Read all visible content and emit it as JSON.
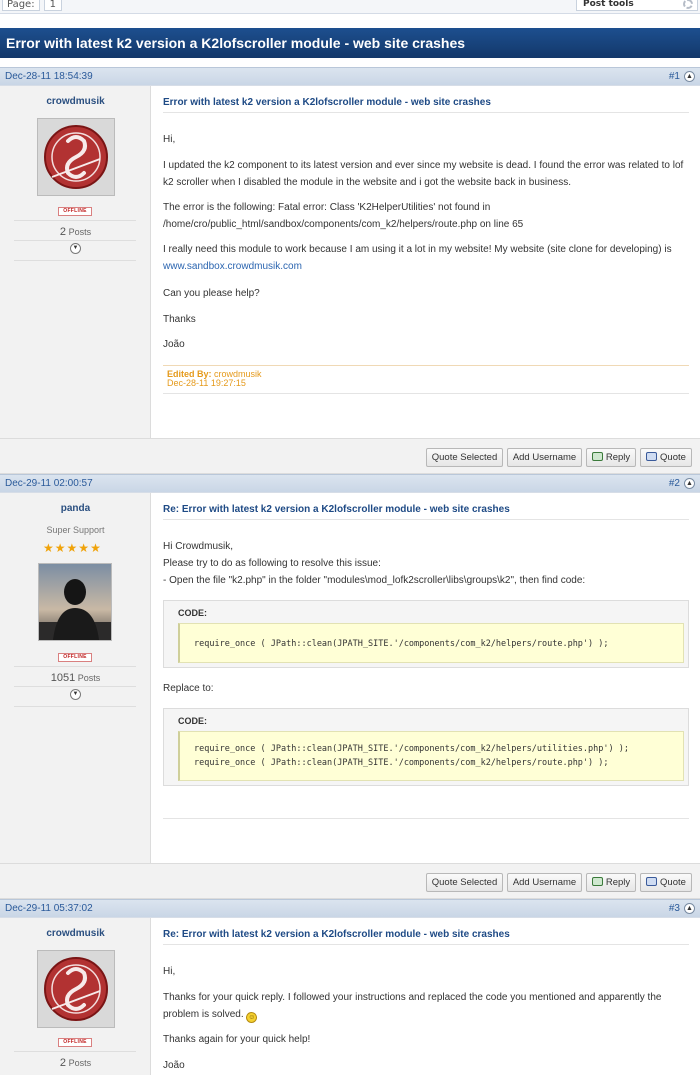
{
  "pager": {
    "label": "Page:",
    "current": "1"
  },
  "post_tools": "Post tools",
  "thread_title": "Error with latest k2 version a K2lofscroller module - web site crashes",
  "buttons": {
    "quote_selected": "Quote Selected",
    "add_username": "Add Username",
    "reply": "Reply",
    "quote": "Quote"
  },
  "posts": [
    {
      "date": "Dec-28-11 18:54:39",
      "number": "#1",
      "author": "crowdmusik",
      "status": "OFFLINE",
      "post_count": "2",
      "posts_label": "Posts",
      "subject": "Error with latest k2 version a K2lofscroller module - web site crashes",
      "paragraphs": [
        "Hi,",
        "I updated the k2 component to its latest version and ever since my website is dead. I found the error was related to lof k2 scroller when I disabled the module in the website and i got the website back in business.",
        "The error is the following: Fatal error: Class 'K2HelperUtilities' not found in /home/cro/public_html/sandbox/components/com_k2/helpers/route.php on line 65",
        "Can you please help?",
        "Thanks",
        "João"
      ],
      "para_with_link": {
        "text": "I really need this module to work because I am using it a lot in my website! My website (site clone for developing) is ",
        "link": "www.sandbox.crowdmusik.com"
      },
      "edited_label": "Edited By:",
      "edited_by": "crowdmusik",
      "edited_date": "Dec-28-11 19:27:15"
    },
    {
      "date": "Dec-29-11 02:00:57",
      "number": "#2",
      "author": "panda",
      "rank": "Super Support",
      "stars": 5,
      "status": "OFFLINE",
      "post_count": "1051",
      "posts_label": "Posts",
      "subject": "Re: Error with latest k2 version a K2lofscroller module - web site crashes",
      "lines": [
        "Hi Crowdmusik,",
        "Please try to do as following to resolve this issue:",
        "- Open the file \"k2.php\" in the folder \"modules\\mod_lofk2scroller\\libs\\groups\\k2\", then find code:"
      ],
      "code_label": "CODE:",
      "code1": [
        "require_once ( JPath::clean(JPATH_SITE.'/components/com_k2/helpers/route.php') );"
      ],
      "replace_text": "Replace to:",
      "code2": [
        "require_once ( JPath::clean(JPATH_SITE.'/components/com_k2/helpers/utilities.php') );",
        "require_once ( JPath::clean(JPATH_SITE.'/components/com_k2/helpers/route.php') );"
      ]
    },
    {
      "date": "Dec-29-11 05:37:02",
      "number": "#3",
      "author": "crowdmusik",
      "status": "OFFLINE",
      "post_count": "2",
      "posts_label": "Posts",
      "subject": "Re: Error with latest k2 version a K2lofscroller module - web site crashes",
      "paragraphs": [
        "Hi,",
        "Thanks for your quick reply. I followed your instructions and replaced the code you mentioned and apparently the problem is solved.",
        "Thanks again for your quick help!",
        "João"
      ],
      "smiley": "smiley-icon"
    }
  ]
}
